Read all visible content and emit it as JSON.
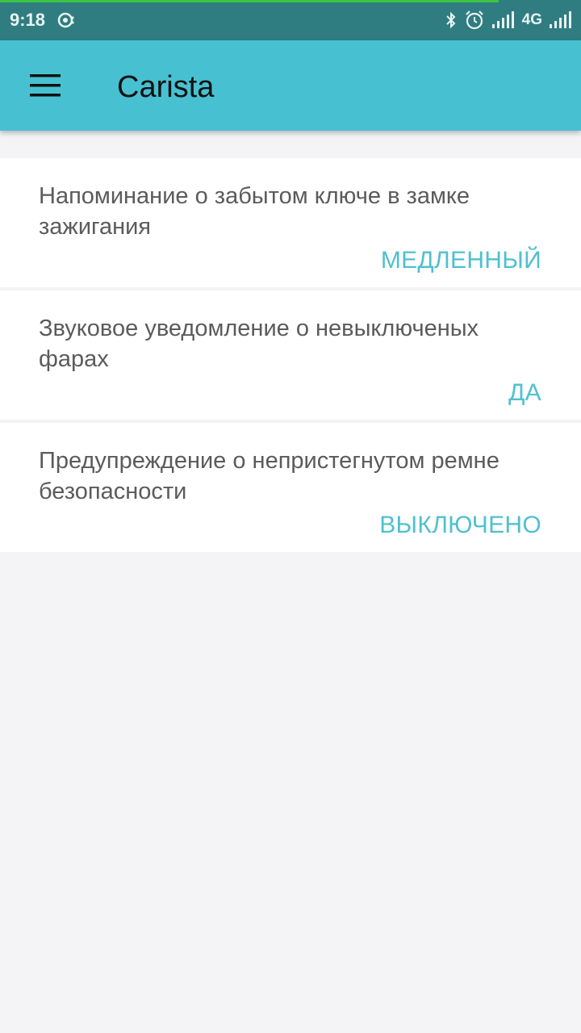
{
  "status_bar": {
    "time": "9:18",
    "network": "4G",
    "icons": [
      "sync-icon",
      "bluetooth-icon",
      "alarm-icon",
      "signal-icon",
      "signal-icon-2"
    ]
  },
  "app_bar": {
    "title": "Carista",
    "menu_icon": "hamburger-menu-icon"
  },
  "settings": [
    {
      "label": "Напоминание о забытом ключе в замке зажигания",
      "value": "МЕДЛЕННЫЙ"
    },
    {
      "label": "Звуковое уведомление о невыключеных фарах",
      "value": "ДА"
    },
    {
      "label": "Предупреждение о непристегнутом ремне безопасности",
      "value": "ВЫКЛЮЧЕНО"
    }
  ],
  "colors": {
    "status_bar": "#2f7d80",
    "app_bar": "#47c1d1",
    "accent_value": "#4fc0cf",
    "background": "#f4f4f6"
  }
}
